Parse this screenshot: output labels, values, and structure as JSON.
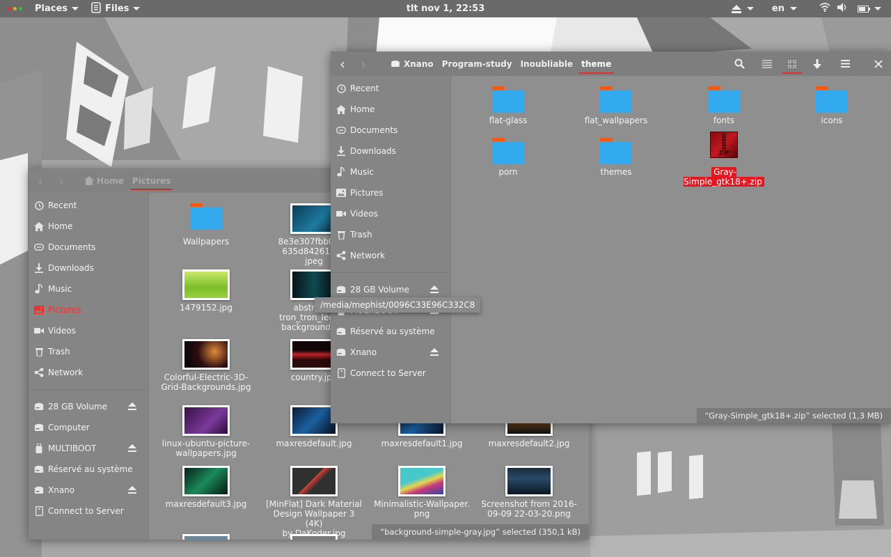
{
  "topbar": {
    "places_label": "Places",
    "files_label": "Files",
    "clock": "tlt nov  1, 22:53",
    "lang": "en"
  },
  "back_window": {
    "breadcrumbs": [
      "Home",
      "Pictures"
    ],
    "sidebar": [
      {
        "label": "Recent",
        "icon": "clock-icon"
      },
      {
        "label": "Home",
        "icon": "home-icon"
      },
      {
        "label": "Documents",
        "icon": "documents-icon"
      },
      {
        "label": "Downloads",
        "icon": "download-icon"
      },
      {
        "label": "Music",
        "icon": "music-icon"
      },
      {
        "label": "Pictures",
        "icon": "pictures-icon",
        "active": true
      },
      {
        "label": "Videos",
        "icon": "video-icon"
      },
      {
        "label": "Trash",
        "icon": "trash-icon"
      },
      {
        "label": "Network",
        "icon": "network-icon"
      }
    ],
    "devices": [
      {
        "label": "28 GB Volume",
        "icon": "drive-icon",
        "eject": true
      },
      {
        "label": "Computer",
        "icon": "drive-icon",
        "eject": false
      },
      {
        "label": "MULTIBOOT",
        "icon": "usb-icon",
        "eject": true
      },
      {
        "label": "Réservé au système",
        "icon": "drive-icon",
        "eject": false
      },
      {
        "label": "Xnano",
        "icon": "drive-icon",
        "eject": true
      },
      {
        "label": "Connect to Server",
        "icon": "server-icon",
        "eject": false
      }
    ],
    "files": [
      {
        "name": "Wallpapers",
        "type": "folder"
      },
      {
        "name": "8e3e307fbb0b78\n635d842612e1\njpeg",
        "type": "image"
      },
      {
        "name": "1479152.jpg",
        "type": "image"
      },
      {
        "name": "abstract_l\ntron_tron_legacy\nbackgrounds_al",
        "type": "image"
      },
      {
        "name": "Colorful-Electric-3D-\nGrid-Backgrounds.jpg",
        "type": "image"
      },
      {
        "name": "country.jpg",
        "type": "image"
      },
      {
        "name": "linux-ubuntu-picture-\nwallpapers.jpg",
        "type": "image"
      },
      {
        "name": "maxresdefault.jpg",
        "type": "image"
      },
      {
        "name": "maxresdefault1.jpg",
        "type": "image"
      },
      {
        "name": "maxresdefault2.jpg",
        "type": "image"
      },
      {
        "name": "maxresdefault3.jpg",
        "type": "image"
      },
      {
        "name": "[MinFlat] Dark Material\nDesign Wallpaper 3 (4K)\nby DaKoder.jpg",
        "type": "image"
      },
      {
        "name": "Minimalistic-Wallpaper.\npng",
        "type": "image"
      },
      {
        "name": "Screenshot from 2016-\n09-09 22-03-20.png",
        "type": "image"
      }
    ],
    "status": "“background-simple-gray.jpg” selected  (350,1 kB)"
  },
  "front_window": {
    "breadcrumbs": [
      "Xnano",
      "Program-study",
      "Inoubliable",
      "theme"
    ],
    "sidebar": [
      {
        "label": "Recent",
        "icon": "clock-icon"
      },
      {
        "label": "Home",
        "icon": "home-icon"
      },
      {
        "label": "Documents",
        "icon": "documents-icon"
      },
      {
        "label": "Downloads",
        "icon": "download-icon"
      },
      {
        "label": "Music",
        "icon": "music-icon"
      },
      {
        "label": "Pictures",
        "icon": "pictures-icon"
      },
      {
        "label": "Videos",
        "icon": "video-icon"
      },
      {
        "label": "Trash",
        "icon": "trash-icon"
      },
      {
        "label": "Network",
        "icon": "network-icon"
      }
    ],
    "devices": [
      {
        "label": "28 GB Volume",
        "icon": "drive-icon",
        "eject": true
      },
      {
        "label": "MULTIBOOT",
        "icon": "usb-icon",
        "eject": true
      },
      {
        "label": "Réservé au système",
        "icon": "drive-icon",
        "eject": false
      },
      {
        "label": "Xnano",
        "icon": "drive-icon",
        "eject": true
      },
      {
        "label": "Connect to Server",
        "icon": "server-icon",
        "eject": false
      }
    ],
    "tooltip": "/media/mephist/0096C33E96C332C8",
    "files": [
      {
        "name": "flat-glass",
        "type": "folder"
      },
      {
        "name": "flat_wallpapers",
        "type": "folder"
      },
      {
        "name": "fonts",
        "type": "folder"
      },
      {
        "name": "icons",
        "type": "folder"
      },
      {
        "name": "porn",
        "type": "folder"
      },
      {
        "name": "themes",
        "type": "folder"
      },
      {
        "name": "Gray-Simple_gtk18+.zip",
        "type": "archive",
        "selected": true
      }
    ],
    "status": "“Gray-Simple_gtk18+.zip” selected  (1,3 MB)"
  },
  "colors": {
    "accent": "#e52b2b",
    "folder": "#33aaee",
    "folder_tab": "#f25a14"
  }
}
